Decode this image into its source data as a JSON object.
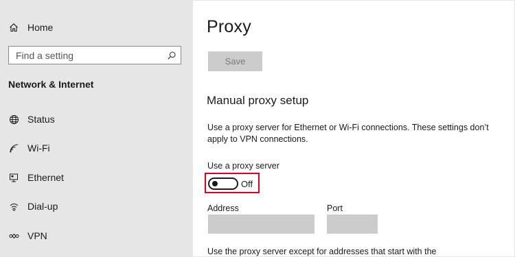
{
  "sidebar": {
    "home_label": "Home",
    "search_placeholder": "Find a setting",
    "section_title": "Network & Internet",
    "items": [
      {
        "label": "Status",
        "icon": "globe-icon"
      },
      {
        "label": "Wi-Fi",
        "icon": "wifi-icon"
      },
      {
        "label": "Ethernet",
        "icon": "ethernet-icon"
      },
      {
        "label": "Dial-up",
        "icon": "dialup-icon"
      },
      {
        "label": "VPN",
        "icon": "vpn-icon"
      }
    ]
  },
  "main": {
    "title": "Proxy",
    "save_label": "Save",
    "manual_heading": "Manual proxy setup",
    "description": "Use a proxy server for Ethernet or Wi-Fi connections. These settings don’t apply to VPN connections.",
    "toggle_label": "Use a proxy server",
    "toggle_state": "Off",
    "address_label": "Address",
    "port_label": "Port",
    "address_value": "",
    "port_value": "",
    "exceptions_text": "Use the proxy server except for addresses that start with the"
  },
  "colors": {
    "sidebar_bg": "#e6e6e6",
    "disabled_bg": "#cccccc",
    "highlight": "#e3001b"
  }
}
